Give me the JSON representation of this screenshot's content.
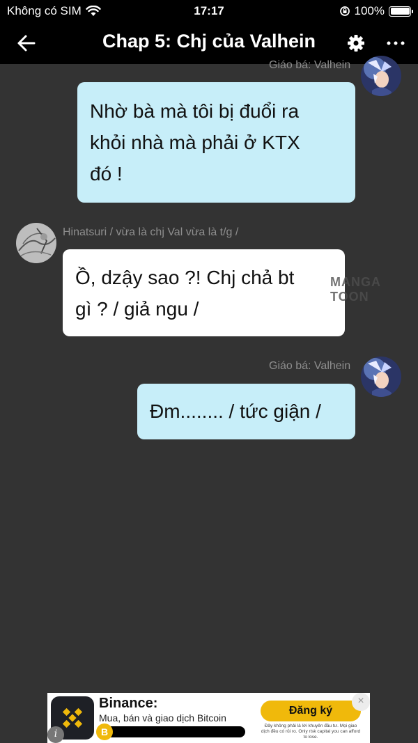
{
  "status_bar": {
    "carrier": "Không có SIM",
    "time": "17:17",
    "battery": "100%",
    "battery_level": 1.0
  },
  "header": {
    "title": "Chap 5: Chj của Valhein",
    "back_icon": "arrow-left-icon",
    "settings_icon": "gear-icon",
    "more_icon": "ellipsis-icon"
  },
  "messages": [
    {
      "side": "right",
      "sender": "Giáo bá: Valhein",
      "lines": [
        "Nhờ bà mà tôi bị đuổi ra",
        "khỏi nhà mà phải ở KTX",
        "đó !"
      ]
    },
    {
      "side": "left",
      "sender": "Hinatsuri / vừa là chj Val vừa là t/g /",
      "lines": [
        "Ồ, dzậy sao ?! Chj chả bt",
        "gì ? / giả ngu /"
      ]
    },
    {
      "side": "right",
      "sender": "Giáo bá: Valhein",
      "lines": [
        "Đm........ / tức giận /"
      ]
    }
  ],
  "watermark": "MANGA TOON",
  "ad": {
    "title": "Binance:",
    "subtitle": "Mua, bán và giao dịch Bitcoin",
    "cta": "Đăng ký",
    "coin_symbol": "B",
    "disclaimer": "Đây không phải là lời khuyên đầu tư. Mọi giao dịch đều có rủi ro. Only risk capital you can afford to lose.",
    "close_icon": "close-icon",
    "info_icon": "info-icon",
    "brand_color": "#f0b90b"
  },
  "colors": {
    "background": "#333333",
    "bar": "#000000",
    "bubble_right": "#c7eef9",
    "bubble_left": "#ffffff",
    "sender_text": "#8e8e8e"
  }
}
